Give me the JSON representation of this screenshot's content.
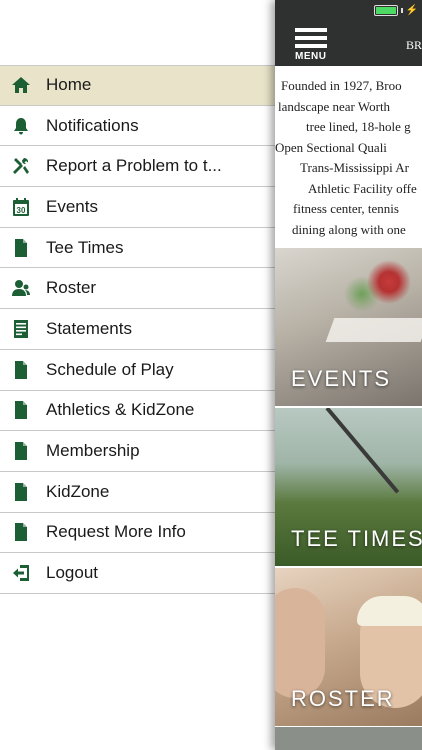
{
  "menu": {
    "items": [
      {
        "label": "Home",
        "icon": "home-icon",
        "active": true
      },
      {
        "label": "Notifications",
        "icon": "bell-icon",
        "active": false
      },
      {
        "label": "Report a Problem to t...",
        "icon": "tools-icon",
        "active": false
      },
      {
        "label": "Events",
        "icon": "calendar-icon",
        "active": false
      },
      {
        "label": "Tee Times",
        "icon": "document-icon",
        "active": false
      },
      {
        "label": "Roster",
        "icon": "people-icon",
        "active": false
      },
      {
        "label": "Statements",
        "icon": "statement-icon",
        "active": false
      },
      {
        "label": "Schedule of Play",
        "icon": "document-icon",
        "active": false
      },
      {
        "label": "Athletics & KidZone",
        "icon": "document-icon",
        "active": false
      },
      {
        "label": "Membership",
        "icon": "document-icon",
        "active": false
      },
      {
        "label": "KidZone",
        "icon": "document-icon",
        "active": false
      },
      {
        "label": "Request More Info",
        "icon": "document-icon",
        "active": false
      },
      {
        "label": "Logout",
        "icon": "logout-icon",
        "active": false
      }
    ],
    "calendar_day": "30"
  },
  "topbar": {
    "menu_caption": "MENU",
    "club_abbrev": "BR"
  },
  "intro": {
    "lines": [
      "Founded in 1927, Broo",
      "landscape near Worth",
      "tree lined, 18-hole g",
      "Open Sectional Quali",
      "Trans-Mississippi Ar",
      "Athletic Facility offe",
      "fitness center, tennis",
      "dining along with one"
    ]
  },
  "tiles": [
    {
      "label": "EVENTS"
    },
    {
      "label": "TEE TIMES"
    },
    {
      "label": "ROSTER"
    }
  ],
  "colors": {
    "accent_green": "#1d5f35",
    "active_row": "#e9e4c9",
    "topbar": "#2f3030",
    "battery": "#4cd964"
  }
}
